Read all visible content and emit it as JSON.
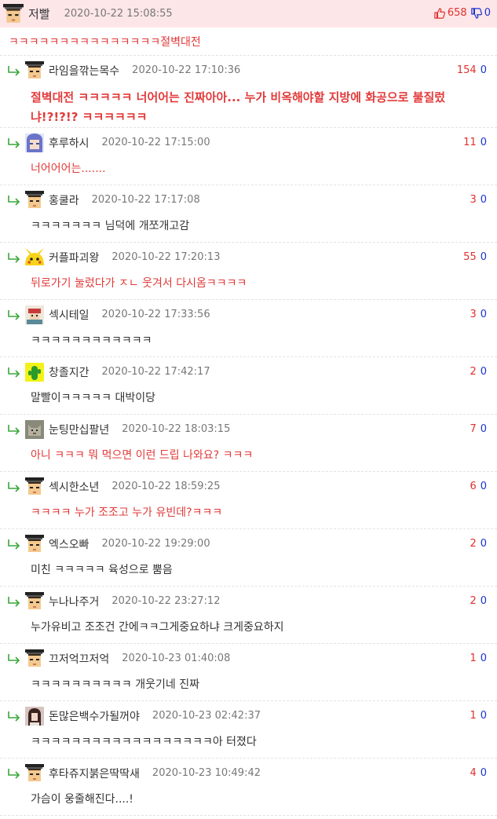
{
  "main_post": {
    "nick": "저빨",
    "date": "2020-10-22 15:08:55",
    "up": "658",
    "down": "0",
    "body": "ㅋㅋㅋㅋㅋㅋㅋㅋㅋㅋㅋㅋㅋㅋㅋ절벽대전",
    "accent_color": "#fde6e8"
  },
  "replies": [
    {
      "nick": "라임을깎는목수",
      "date": "2020-10-22 17:10:36",
      "up": "154",
      "down": "0",
      "avatar": "default-avatar",
      "body": "절벽대전 ㅋㅋㅋㅋㅋ 너어어는 진짜아아... 누가 비옥해야할 지방에 화공으로 불질렀냐!?!?!? ㅋㅋㅋㅋㅋㅋ",
      "style": "red"
    },
    {
      "nick": "후루하시",
      "date": "2020-10-22 17:15:00",
      "up": "11",
      "down": "0",
      "avatar": "anime-avatar",
      "body": "너어어어는.......",
      "style": "red"
    },
    {
      "nick": "홍쿨라",
      "date": "2020-10-22 17:17:08",
      "up": "3",
      "down": "0",
      "avatar": "default-avatar",
      "body": "ㅋㅋㅋㅋㅋㅋㅋ 님덕에 개쪼개고감",
      "style": "black"
    },
    {
      "nick": "커플파괴왕",
      "date": "2020-10-22 17:20:13",
      "up": "55",
      "down": "0",
      "avatar": "pikachu-avatar",
      "body": "뒤로가기 눌렀다가 ㅈㄴ 웃겨서 다시옴ㅋㅋㅋㅋ",
      "style": "red"
    },
    {
      "nick": "섹시테일",
      "date": "2020-10-22 17:33:56",
      "up": "3",
      "down": "0",
      "avatar": "pixel-art-avatar",
      "body": "ㅋㅋㅋㅋㅋㅋㅋㅋㅋㅋㅋㅋ",
      "style": "black"
    },
    {
      "nick": "창졸지간",
      "date": "2020-10-22 17:42:17",
      "up": "2",
      "down": "0",
      "avatar": "cactus-avatar",
      "body": "말빨이ㅋㅋㅋㅋㅋ 대박이당",
      "style": "black"
    },
    {
      "nick": "눈팅만십팔년",
      "date": "2020-10-22 18:03:15",
      "up": "7",
      "down": "0",
      "avatar": "cat-avatar",
      "body": "아니 ㅋㅋㅋ 뭐 먹으면 이런 드립 나와요? ㅋㅋㅋ",
      "style": "red"
    },
    {
      "nick": "섹시한소년",
      "date": "2020-10-22 18:59:25",
      "up": "6",
      "down": "0",
      "avatar": "default-avatar",
      "body": "ㅋㅋㅋㅋ 누가 조조고 누가 유빈데?ㅋㅋㅋ",
      "style": "red"
    },
    {
      "nick": "엑스오빠",
      "date": "2020-10-22 19:29:00",
      "up": "2",
      "down": "0",
      "avatar": "default-avatar",
      "body": "미친 ㅋㅋㅋㅋㅋ 육성으로 뿜음",
      "style": "black"
    },
    {
      "nick": "누나나주거",
      "date": "2020-10-22 23:27:12",
      "up": "2",
      "down": "0",
      "avatar": "default-avatar",
      "body": "누가유비고 조조건 간에ㅋㅋ그게중요하냐 크게중요하지",
      "style": "black"
    },
    {
      "nick": "끄저억끄저억",
      "date": "2020-10-23 01:40:08",
      "up": "1",
      "down": "0",
      "avatar": "default-avatar",
      "body": "ㅋㅋㅋㅋㅋㅋㅋㅋㅋㅋ 개웃기네 진짜",
      "style": "black"
    },
    {
      "nick": "돈많은백수가될꺼야",
      "date": "2020-10-23 02:42:37",
      "up": "1",
      "down": "0",
      "avatar": "photo-avatar",
      "body": "ㅋㅋㅋㅋㅋㅋㅋㅋㅋㅋㅋㅋㅋㅋㅋㅋㅋㅋ아 터졌다",
      "style": "black"
    },
    {
      "nick": "후타쥬지붉은딱딱새",
      "date": "2020-10-23 10:49:42",
      "up": "4",
      "down": "0",
      "avatar": "default-avatar",
      "body": "가슴이 웅줄해진다....!",
      "style": "black"
    }
  ],
  "icons": {
    "thumb_up": "thumbs-up-icon",
    "thumb_down": "thumbs-down-icon",
    "reply_arrow": "reply-arrow-icon"
  },
  "colors": {
    "up": "#e0302c",
    "down": "#1b34cc",
    "red_text": "#e23a3a",
    "arrow": "#3aa63a"
  }
}
